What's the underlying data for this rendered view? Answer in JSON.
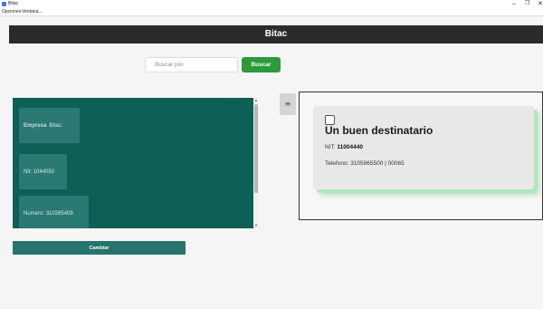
{
  "window": {
    "title": "Bitac",
    "min_glyph": "–",
    "max_glyph": "❐",
    "close_glyph": "✕",
    "icon": "app-icon"
  },
  "menu": {
    "items": [
      "Opciones",
      "Ventana..."
    ]
  },
  "header": {
    "title": "Bitac"
  },
  "search": {
    "placeholder": "Buscar por",
    "value": "",
    "button_label": "Buscar"
  },
  "company": {
    "empresa_label": "Empresa",
    "empresa_value": "Bitac",
    "nit_label": "Nit",
    "nit_value": "1044050",
    "numero_label": "Numero",
    "numero_value": "310265409"
  },
  "change_button_label": "Cambiar",
  "menu_toggle_glyph": "≡",
  "recipient": {
    "title": "Un buen destinatario",
    "nit_label": "NIT:",
    "nit_value": "11004440",
    "phone_label": "Telefono:",
    "phone_value": "3105965500 | 00065"
  },
  "colors": {
    "header_bg": "#2b2b2b",
    "panel_bg": "#0e5f56",
    "accent_green": "#2b9a3c",
    "button_teal": "#26746c"
  }
}
